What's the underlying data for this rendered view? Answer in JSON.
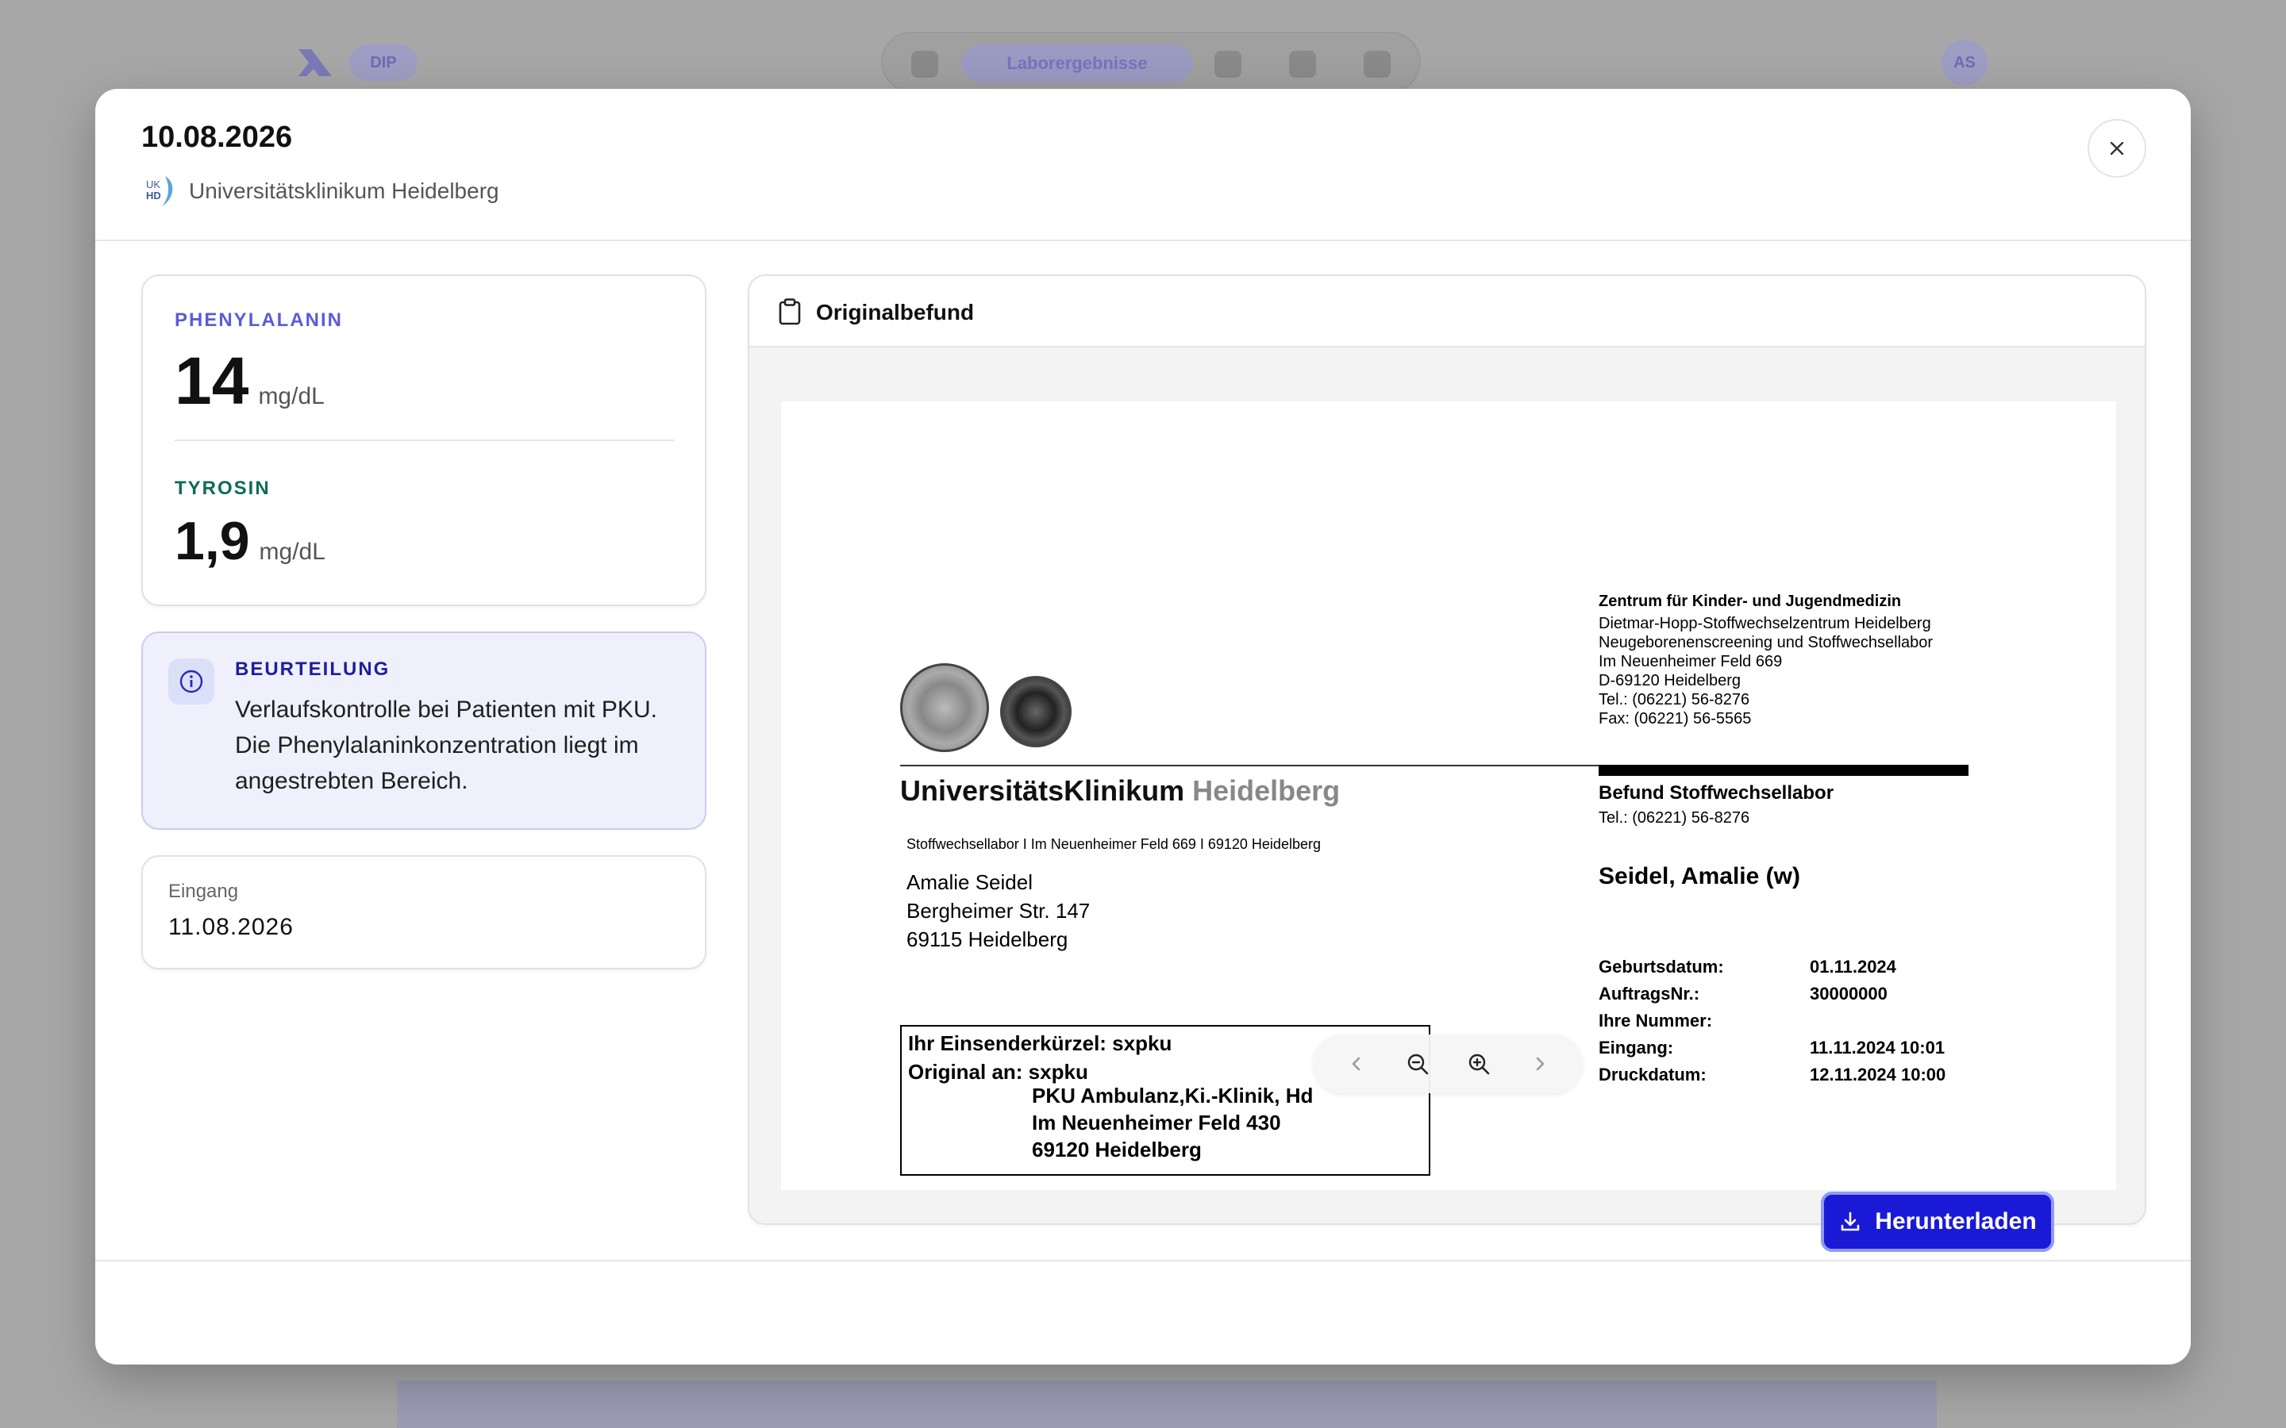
{
  "background": {
    "chip": "DIP",
    "nav_active": "Laborergebnisse",
    "avatar": "AS"
  },
  "modal": {
    "title": "10.08.2026",
    "issuer": "Universitätsklinikum Heidelberg",
    "issuer_logo_text": "UKHD",
    "close_icon": "close-icon"
  },
  "values": {
    "phe": {
      "label": "PHENYLALANIN",
      "value": "14",
      "unit": "mg/dL",
      "color": "#5b5bd6"
    },
    "tyr": {
      "label": "TYROSIN",
      "value": "1,9",
      "unit": "mg/dL",
      "color": "#0f6b55"
    }
  },
  "assessment": {
    "title": "BEURTEILUNG",
    "text": "Verlaufskontrolle bei Patienten mit PKU. Die Phenylalaninkonzentration liegt im angestrebten Bereich."
  },
  "entry": {
    "label": "Eingang",
    "value": "11.08.2026"
  },
  "document": {
    "title": "Originalbefund",
    "org_line1": "Zentrum für Kinder- und Jugendmedizin",
    "org_line2": "Dietmar-Hopp-Stoffwechselzentrum Heidelberg",
    "org_line3": "Neugeborenenscreening und Stoffwechsellabor",
    "org_line4": "Im Neuenheimer Feld 669",
    "org_line5": "D-69120 Heidelberg",
    "org_line6": "Tel.: (06221) 56-8276",
    "org_line7": "Fax: (06221) 56-5565",
    "clinic_name_a": "UniversitätsKlinikum",
    "clinic_name_b": "Heidelberg",
    "sender_line": "Stoffwechsellabor I Im Neuenheimer Feld 669 I 69120 Heidelberg",
    "addr_name": "Amalie Seidel",
    "addr_street": "Bergheimer Str. 147",
    "addr_city": "69115 Heidelberg",
    "befund_title": "Befund Stoffwechsellabor",
    "befund_tel": "Tel.: (06221) 56-8276",
    "patient": "Seidel, Amalie (w)",
    "fields": [
      {
        "k": "Geburtsdatum:",
        "v": "01.11.2024"
      },
      {
        "k": "AuftragsNr.:",
        "v": "30000000"
      },
      {
        "k": "Ihre Nummer:",
        "v": ""
      },
      {
        "k": "Eingang:",
        "v": "11.11.2024 10:01"
      },
      {
        "k": "Druckdatum:",
        "v": "12.11.2024 10:00"
      }
    ],
    "box_line1": "Ihr Einsenderkürzel: sxpku",
    "box_line2": "Original an: sxpku",
    "box_line3": "PKU Ambulanz,Ki.-Klinik, Hd",
    "box_line4": "Im Neuenheimer Feld 430",
    "box_line5": "69120 Heidelberg"
  },
  "footer": {
    "download_label": "Herunterladen"
  }
}
